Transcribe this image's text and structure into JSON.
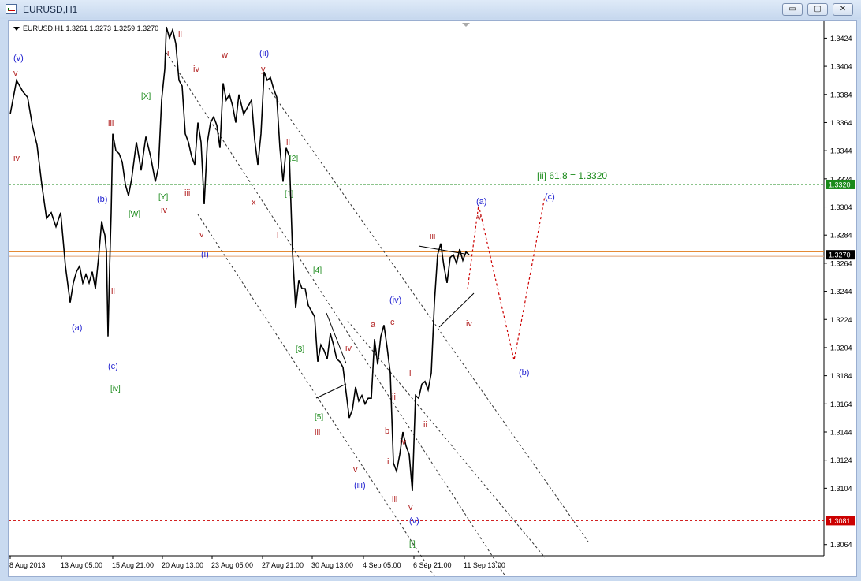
{
  "window": {
    "title": "EURUSD,H1",
    "controls": {
      "minimize": "▭",
      "restore": "▢",
      "close": "✕"
    }
  },
  "chart_info": {
    "symbol_line": "EURUSD,H1  1.3261 1.3273 1.3259 1.3270"
  },
  "chart_data": {
    "type": "line",
    "symbol": "EURUSD",
    "timeframe": "H1",
    "ohlc_current": {
      "open": 1.3261,
      "high": 1.3273,
      "low": 1.3259,
      "close": 1.327
    },
    "y_ticks": [
      "1.3424",
      "1.3404",
      "1.3384",
      "1.3364",
      "1.3344",
      "1.3324",
      "1.3304",
      "1.3284",
      "1.3264",
      "1.3244",
      "1.3224",
      "1.3204",
      "1.3184",
      "1.3164",
      "1.3144",
      "1.3124",
      "1.3104",
      "1.3064"
    ],
    "x_ticks": [
      "8 Aug 2013",
      "13 Aug 05:00",
      "15 Aug 21:00",
      "20 Aug 13:00",
      "23 Aug 05:00",
      "27 Aug 21:00",
      "30 Aug 13:00",
      "4 Sep 05:00",
      "6 Sep 21:00",
      "11 Sep 13:00"
    ],
    "ylim": [
      1.3056,
      1.3436
    ],
    "price_series": [
      [
        0,
        1.337
      ],
      [
        8,
        1.3394
      ],
      [
        16,
        1.3386
      ],
      [
        22,
        1.3382
      ],
      [
        28,
        1.3362
      ],
      [
        34,
        1.3348
      ],
      [
        40,
        1.332
      ],
      [
        46,
        1.3296
      ],
      [
        52,
        1.33
      ],
      [
        58,
        1.329
      ],
      [
        64,
        1.33
      ],
      [
        70,
        1.3262
      ],
      [
        76,
        1.3236
      ],
      [
        80,
        1.325
      ],
      [
        84,
        1.3258
      ],
      [
        88,
        1.3262
      ],
      [
        92,
        1.325
      ],
      [
        96,
        1.3256
      ],
      [
        100,
        1.325
      ],
      [
        104,
        1.3258
      ],
      [
        108,
        1.3246
      ],
      [
        112,
        1.3268
      ],
      [
        116,
        1.3294
      ],
      [
        118,
        1.3288
      ],
      [
        120,
        1.3284
      ],
      [
        122,
        1.3272
      ],
      [
        124,
        1.3212
      ],
      [
        126,
        1.326
      ],
      [
        128,
        1.33
      ],
      [
        130,
        1.3356
      ],
      [
        134,
        1.3344
      ],
      [
        138,
        1.3342
      ],
      [
        142,
        1.3336
      ],
      [
        146,
        1.332
      ],
      [
        150,
        1.3312
      ],
      [
        154,
        1.3324
      ],
      [
        160,
        1.335
      ],
      [
        166,
        1.333
      ],
      [
        172,
        1.3354
      ],
      [
        178,
        1.334
      ],
      [
        184,
        1.3322
      ],
      [
        188,
        1.3332
      ],
      [
        192,
        1.338
      ],
      [
        196,
        1.3402
      ],
      [
        198,
        1.3432
      ],
      [
        202,
        1.3424
      ],
      [
        206,
        1.343
      ],
      [
        210,
        1.342
      ],
      [
        214,
        1.3394
      ],
      [
        218,
        1.339
      ],
      [
        222,
        1.3356
      ],
      [
        226,
        1.335
      ],
      [
        230,
        1.334
      ],
      [
        234,
        1.3334
      ],
      [
        238,
        1.3364
      ],
      [
        242,
        1.335
      ],
      [
        246,
        1.3306
      ],
      [
        250,
        1.335
      ],
      [
        254,
        1.3364
      ],
      [
        258,
        1.3368
      ],
      [
        262,
        1.3362
      ],
      [
        266,
        1.3346
      ],
      [
        270,
        1.3392
      ],
      [
        274,
        1.338
      ],
      [
        278,
        1.3384
      ],
      [
        282,
        1.3376
      ],
      [
        286,
        1.3364
      ],
      [
        290,
        1.3384
      ],
      [
        296,
        1.337
      ],
      [
        302,
        1.3376
      ],
      [
        306,
        1.338
      ],
      [
        310,
        1.3352
      ],
      [
        314,
        1.3334
      ],
      [
        318,
        1.3356
      ],
      [
        322,
        1.34
      ],
      [
        326,
        1.3394
      ],
      [
        330,
        1.3396
      ],
      [
        334,
        1.3388
      ],
      [
        338,
        1.3382
      ],
      [
        342,
        1.3346
      ],
      [
        346,
        1.3322
      ],
      [
        350,
        1.3346
      ],
      [
        354,
        1.334
      ],
      [
        358,
        1.3272
      ],
      [
        362,
        1.3232
      ],
      [
        366,
        1.3252
      ],
      [
        370,
        1.3246
      ],
      [
        374,
        1.3246
      ],
      [
        378,
        1.3234
      ],
      [
        382,
        1.323
      ],
      [
        386,
        1.3226
      ],
      [
        390,
        1.3194
      ],
      [
        394,
        1.3206
      ],
      [
        398,
        1.3202
      ],
      [
        402,
        1.3196
      ],
      [
        406,
        1.3214
      ],
      [
        410,
        1.3206
      ],
      [
        414,
        1.3196
      ],
      [
        418,
        1.3194
      ],
      [
        422,
        1.319
      ],
      [
        426,
        1.3172
      ],
      [
        430,
        1.3154
      ],
      [
        434,
        1.316
      ],
      [
        438,
        1.3176
      ],
      [
        442,
        1.3166
      ],
      [
        446,
        1.317
      ],
      [
        450,
        1.3164
      ],
      [
        454,
        1.3168
      ],
      [
        458,
        1.3168
      ],
      [
        462,
        1.321
      ],
      [
        466,
        1.3192
      ],
      [
        470,
        1.3212
      ],
      [
        474,
        1.322
      ],
      [
        478,
        1.3204
      ],
      [
        482,
        1.3186
      ],
      [
        486,
        1.3122
      ],
      [
        490,
        1.3116
      ],
      [
        494,
        1.3128
      ],
      [
        498,
        1.3144
      ],
      [
        502,
        1.3134
      ],
      [
        506,
        1.3128
      ],
      [
        510,
        1.3102
      ],
      [
        514,
        1.317
      ],
      [
        518,
        1.3168
      ],
      [
        522,
        1.3178
      ],
      [
        526,
        1.318
      ],
      [
        530,
        1.3174
      ],
      [
        534,
        1.3186
      ],
      [
        538,
        1.3236
      ],
      [
        542,
        1.327
      ],
      [
        546,
        1.3278
      ],
      [
        550,
        1.3262
      ],
      [
        554,
        1.325
      ],
      [
        558,
        1.3268
      ],
      [
        562,
        1.327
      ],
      [
        566,
        1.3264
      ],
      [
        570,
        1.3274
      ],
      [
        574,
        1.3266
      ],
      [
        578,
        1.3272
      ],
      [
        582,
        1.327
      ]
    ],
    "annotation": "[ii]  61.8 = 1.3320",
    "price_tags": [
      "1.3320",
      "1.3270",
      "1.3081"
    ],
    "wave_labels": [
      {
        "t": "(v)",
        "c": "blue"
      },
      {
        "t": "v",
        "c": "red"
      },
      {
        "t": "iv",
        "c": "red"
      },
      {
        "t": "iii",
        "c": "red"
      },
      {
        "t": "(b)",
        "c": "blue"
      },
      {
        "t": "(a)",
        "c": "blue"
      },
      {
        "t": "ii",
        "c": "red"
      },
      {
        "t": "(c)",
        "c": "blue"
      },
      {
        "t": "[iv]",
        "c": "green"
      },
      {
        "t": "[X]",
        "c": "green"
      },
      {
        "t": "[W]",
        "c": "green"
      },
      {
        "t": "[Y]",
        "c": "green"
      },
      {
        "t": "iv",
        "c": "red"
      },
      {
        "t": "ii",
        "c": "red"
      },
      {
        "t": "i",
        "c": "red"
      },
      {
        "t": "iv",
        "c": "red"
      },
      {
        "t": "iii",
        "c": "red"
      },
      {
        "t": "v",
        "c": "red"
      },
      {
        "t": "(i)",
        "c": "blue"
      },
      {
        "t": "w",
        "c": "red"
      },
      {
        "t": "(ii)",
        "c": "blue"
      },
      {
        "t": "y",
        "c": "red"
      },
      {
        "t": "x",
        "c": "red"
      },
      {
        "t": "ii",
        "c": "red"
      },
      {
        "t": "[2]",
        "c": "green"
      },
      {
        "t": "[1]",
        "c": "green"
      },
      {
        "t": "i",
        "c": "red"
      },
      {
        "t": "[4]",
        "c": "green"
      },
      {
        "t": "[3]",
        "c": "green"
      },
      {
        "t": "iv",
        "c": "red"
      },
      {
        "t": "[5]",
        "c": "green"
      },
      {
        "t": "iii",
        "c": "red"
      },
      {
        "t": "v",
        "c": "red"
      },
      {
        "t": "(iii)",
        "c": "blue"
      },
      {
        "t": "(iv)",
        "c": "blue"
      },
      {
        "t": "a",
        "c": "red"
      },
      {
        "t": "c",
        "c": "red"
      },
      {
        "t": "b",
        "c": "red"
      },
      {
        "t": "ii",
        "c": "red"
      },
      {
        "t": "i",
        "c": "red"
      },
      {
        "t": "iv",
        "c": "red"
      },
      {
        "t": "iii",
        "c": "red"
      },
      {
        "t": "v",
        "c": "red"
      },
      {
        "t": "(v)",
        "c": "blue"
      },
      {
        "t": "[i]",
        "c": "green"
      },
      {
        "t": "i",
        "c": "red"
      },
      {
        "t": "ii",
        "c": "red"
      },
      {
        "t": "iii",
        "c": "red"
      },
      {
        "t": "iv",
        "c": "red"
      },
      {
        "t": "v",
        "c": "red"
      },
      {
        "t": "(a)",
        "c": "blue"
      },
      {
        "t": "(b)",
        "c": "blue"
      },
      {
        "t": "(c)",
        "c": "blue"
      }
    ],
    "colors": {
      "blue": "#1f1fd0",
      "red": "#b22222",
      "green": "#1a8a1a",
      "price_line": "#000000",
      "fib_line": "#1a8a1a",
      "current": "#e07a18",
      "low_line": "#cc0000"
    }
  }
}
